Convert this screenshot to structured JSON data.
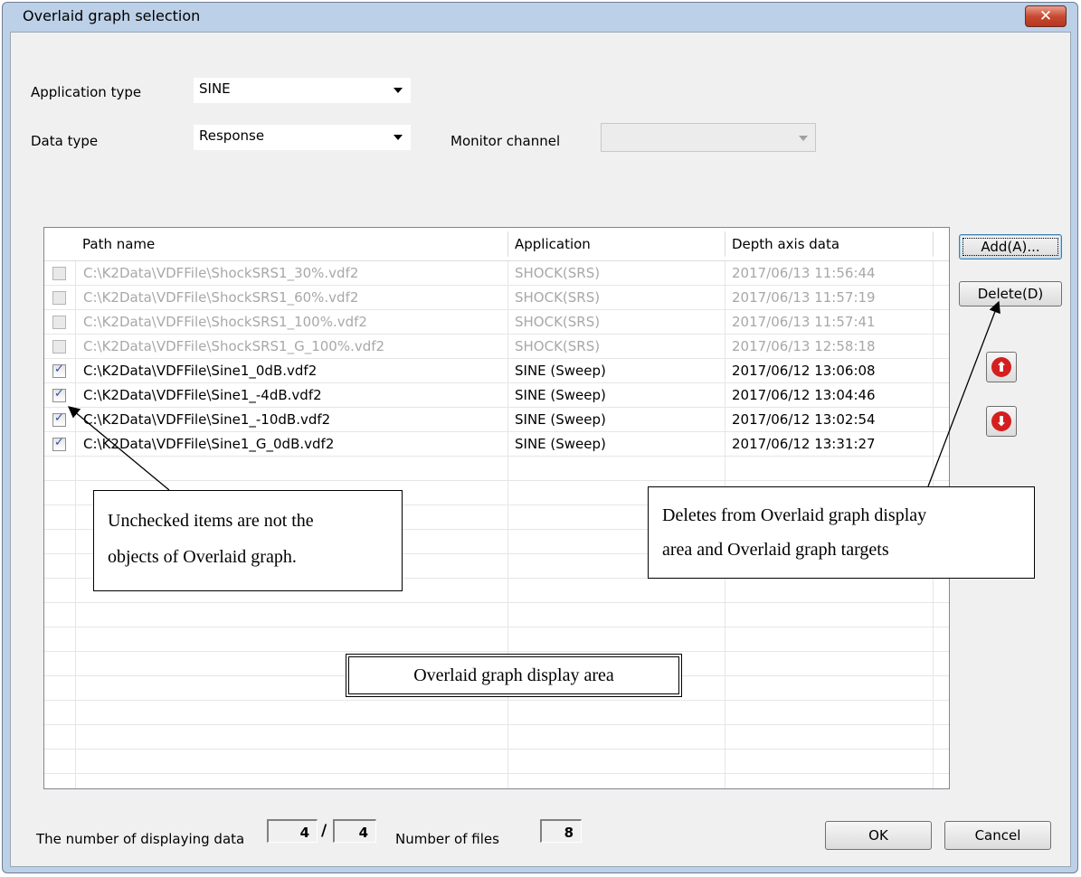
{
  "window": {
    "title": "Overlaid graph selection",
    "close_glyph": "✕"
  },
  "filters": {
    "application_type_label": "Application type",
    "application_type_value": "SINE",
    "data_type_label": "Data type",
    "data_type_value": "Response",
    "monitor_channel_label": "Monitor channel",
    "monitor_channel_value": ""
  },
  "table": {
    "columns": [
      "Path name",
      "Application",
      "Depth axis data"
    ],
    "rows": [
      {
        "checked": false,
        "path": "C:\\K2Data\\VDFFile\\ShockSRS1_30%.vdf2",
        "application": "SHOCK(SRS)",
        "depth": "2017/06/13 11:56:44"
      },
      {
        "checked": false,
        "path": "C:\\K2Data\\VDFFile\\ShockSRS1_60%.vdf2",
        "application": "SHOCK(SRS)",
        "depth": "2017/06/13 11:57:19"
      },
      {
        "checked": false,
        "path": "C:\\K2Data\\VDFFile\\ShockSRS1_100%.vdf2",
        "application": "SHOCK(SRS)",
        "depth": "2017/06/13 11:57:41"
      },
      {
        "checked": false,
        "path": "C:\\K2Data\\VDFFile\\ShockSRS1_G_100%.vdf2",
        "application": "SHOCK(SRS)",
        "depth": "2017/06/13 12:58:18"
      },
      {
        "checked": true,
        "path": "C:\\K2Data\\VDFFile\\Sine1_0dB.vdf2",
        "application": "SINE (Sweep)",
        "depth": "2017/06/12 13:06:08"
      },
      {
        "checked": true,
        "path": "C:\\K2Data\\VDFFile\\Sine1_-4dB.vdf2",
        "application": "SINE (Sweep)",
        "depth": "2017/06/12 13:04:46"
      },
      {
        "checked": true,
        "path": "C:\\K2Data\\VDFFile\\Sine1_-10dB.vdf2",
        "application": "SINE (Sweep)",
        "depth": "2017/06/12 13:02:54"
      },
      {
        "checked": true,
        "path": "C:\\K2Data\\VDFFile\\Sine1_G_0dB.vdf2",
        "application": "SINE (Sweep)",
        "depth": "2017/06/12 13:31:27"
      }
    ],
    "check_glyph": "✓"
  },
  "buttons": {
    "add": "Add(A)...",
    "delete": "Delete(D)",
    "up_glyph": "⬆",
    "down_glyph": "⬇",
    "ok": "OK",
    "cancel": "Cancel"
  },
  "footer": {
    "displaying_label": "The number of displaying data",
    "displaying_count": "4",
    "separator": "/",
    "displaying_total": "4",
    "files_label": "Number of files",
    "files_count": "8"
  },
  "annotations": {
    "unchecked_line1": "Unchecked items are not the",
    "unchecked_line2": "objects of Overlaid graph.",
    "delete_line1": "Deletes from Overlaid graph display",
    "delete_line2": "area and Overlaid graph targets",
    "display_area": "Overlaid graph display area"
  },
  "icons": {
    "close": "close-icon",
    "combo_arrow": "chevron-down-icon",
    "move_up": "arrow-up-icon",
    "move_down": "arrow-down-icon",
    "checkbox": "checkbox-icon"
  },
  "colors": {
    "title_bar": "#bcd0e8",
    "close_button": "#c94a32",
    "dim_text": "#a8a8a8",
    "arrow_disc": "#d51f1f"
  }
}
